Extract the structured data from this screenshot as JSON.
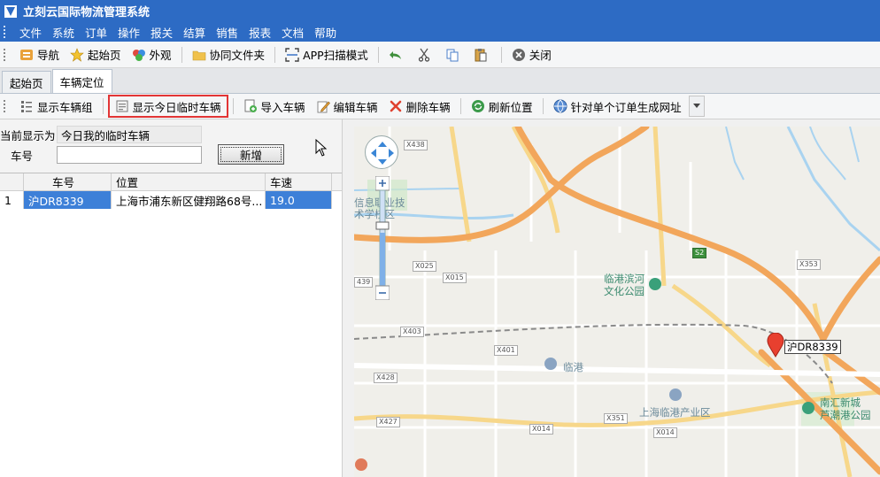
{
  "app": {
    "title": "立刻云国际物流管理系统"
  },
  "menu": [
    "文件",
    "系统",
    "订单",
    "操作",
    "报关",
    "结算",
    "销售",
    "报表",
    "文档",
    "帮助"
  ],
  "toolbar": {
    "nav": "导航",
    "home": "起始页",
    "skin": "外观",
    "shared_folder": "协同文件夹",
    "app_scan": "APP扫描模式",
    "close": "关闭"
  },
  "tabs": [
    {
      "label": "起始页",
      "active": false
    },
    {
      "label": "车辆定位",
      "active": true
    }
  ],
  "toolbar2": {
    "show_group": "显示车辆组",
    "show_today_temp": "显示今日临时车辆",
    "import": "导入车辆",
    "edit": "编辑车辆",
    "delete": "删除车辆",
    "refresh": "刷新位置",
    "gen_url": "针对单个订单生成网址"
  },
  "form": {
    "current_label": "当前显示为",
    "current_value": "今日我的临时车辆",
    "plate_label": "车号",
    "plate_value": "",
    "add_button": "新增"
  },
  "grid": {
    "columns": [
      "车号",
      "位置",
      "车速"
    ],
    "rows": [
      {
        "index": "1",
        "plate": "沪DR8339",
        "location": "上海市浦东新区健翔路68号...",
        "speed": "19.0"
      }
    ]
  },
  "map": {
    "road_labels": [
      "X438",
      "X025",
      "X015",
      "439",
      "X403",
      "X401",
      "X428",
      "X427",
      "X351",
      "X014",
      "X014",
      "X353",
      "S2"
    ],
    "places": {
      "college": "信息职业技\n术学校区",
      "park": "临港滨河\n文化公园",
      "lingang": "临港",
      "industrial": "上海临港产业区",
      "nanhui": "南汇新城\n芦潮港公园"
    },
    "marker_label": "沪DR8339"
  },
  "colors": {
    "title_bar": "#2d6bc4",
    "selection": "#3d80d8",
    "highlight_border": "#e23535",
    "marker": "#e8402f"
  }
}
